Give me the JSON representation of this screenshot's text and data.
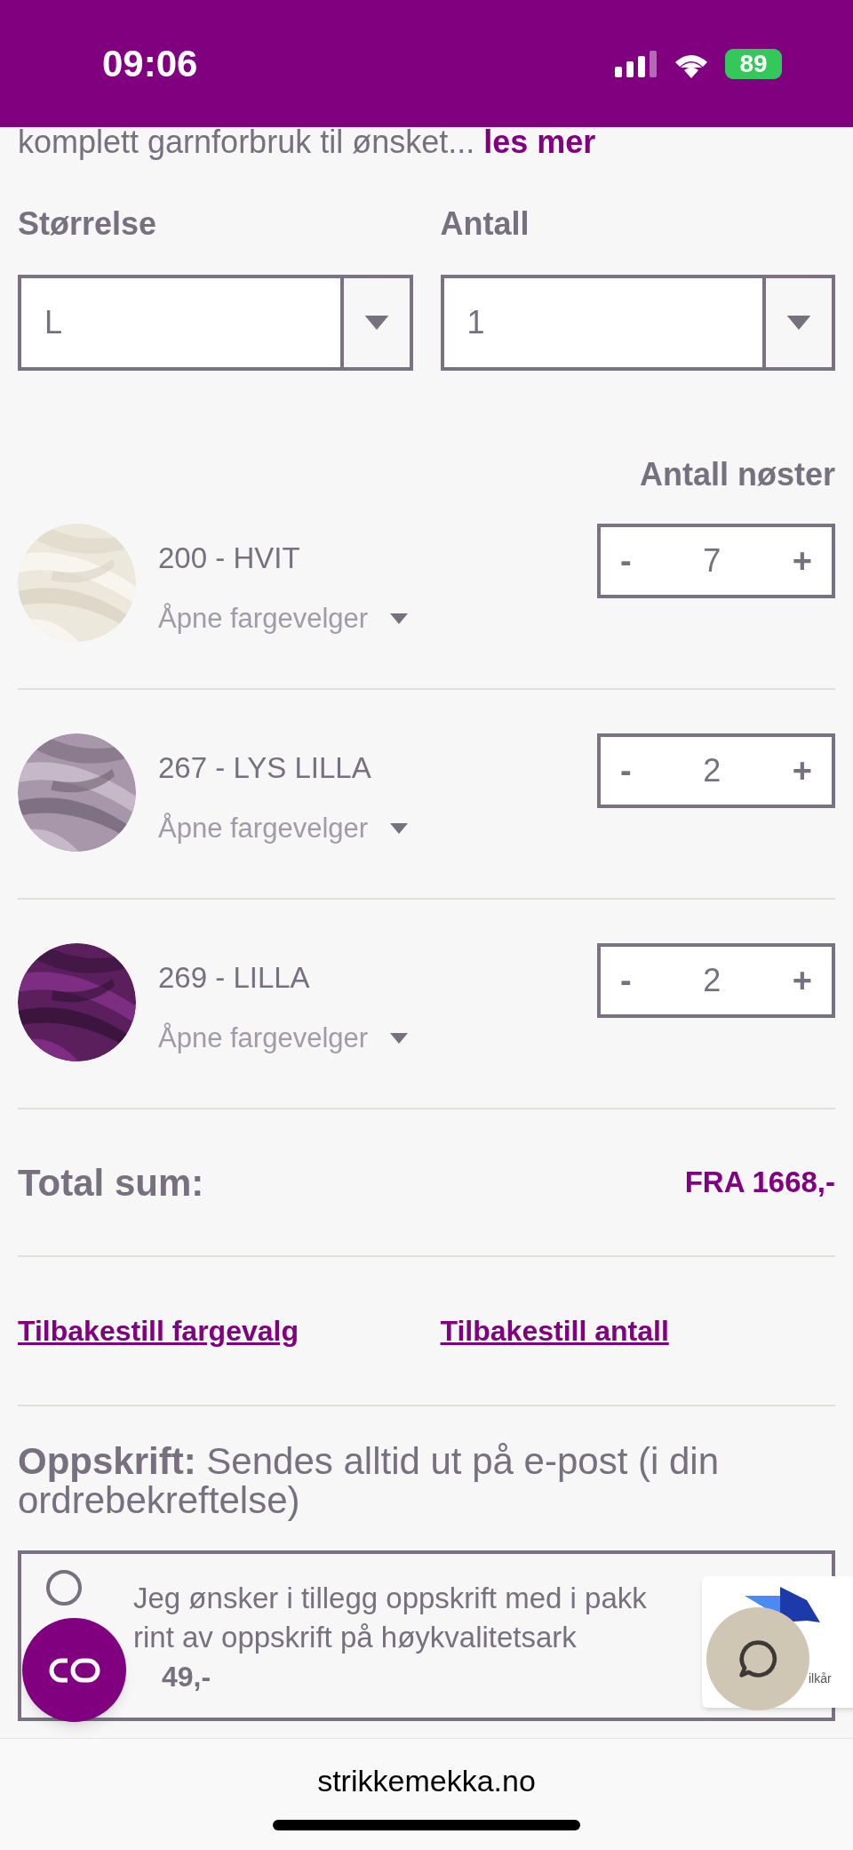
{
  "status_bar": {
    "time": "09:06",
    "battery": "89"
  },
  "intro": {
    "text": "komplett garnforbruk til ønsket...",
    "link": "les mer"
  },
  "selects": [
    {
      "label": "Størrelse",
      "value": "L"
    },
    {
      "label": "Antall",
      "value": "1"
    }
  ],
  "yarn_heading": "Antall nøster",
  "yarns": [
    {
      "name": "200 - HVIT",
      "picker": "Åpne fargevelger",
      "count": "7",
      "decrement": "-",
      "increment": "+"
    },
    {
      "name": "267 - LYS LILLA",
      "picker": "Åpne fargevelger",
      "count": "2",
      "decrement": "-",
      "increment": "+"
    },
    {
      "name": "269 - LILLA",
      "picker": "Åpne fargevelger",
      "count": "2",
      "decrement": "-",
      "increment": "+"
    }
  ],
  "total": {
    "label": "Total sum:",
    "value": "FRA 1668,-"
  },
  "links": [
    "Tilbakestill fargevalg",
    "Tilbakestill antall"
  ],
  "recipe": "**Oppskrift:** Sendes alltid ut på e-post (i din ordrebekreftelse)",
  "recipe_option": {
    "selected": false,
    "lines": [
      "Jeg ønsker i tillegg oppskrift med i pakk",
      "rint av oppskrift på høykvalitetsark"
    ],
    "price": "49,-"
  },
  "recaptcha": {
    "text": "ilkår"
  },
  "url": "strikkemekka.no"
}
